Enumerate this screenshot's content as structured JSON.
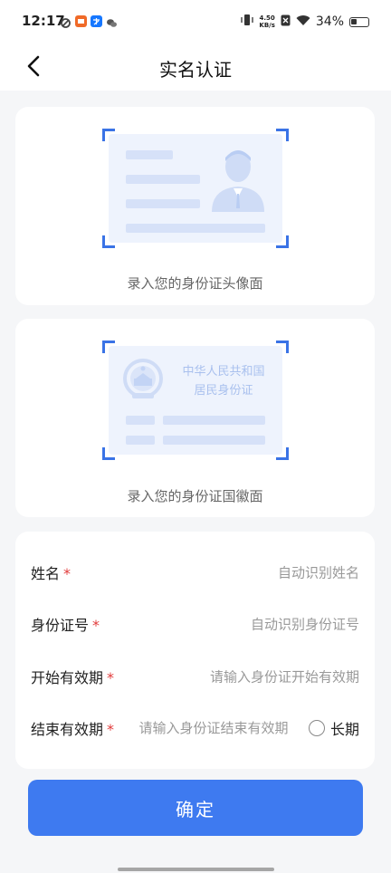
{
  "status_bar": {
    "time": "12:17",
    "net_speed_value": "4.50",
    "net_speed_unit": "KB/s",
    "battery": "34%"
  },
  "header": {
    "title": "实名认证",
    "back_icon": "chevron-left-icon"
  },
  "front_card": {
    "caption": "录入您的身份证头像面"
  },
  "back_card": {
    "emblem_line1": "中华人民共和国",
    "emblem_line2": "居民身份证",
    "caption": "录入您的身份证国徽面"
  },
  "form": {
    "rows": [
      {
        "label": "姓名",
        "required": "*",
        "placeholder": "自动识别姓名"
      },
      {
        "label": "身份证号",
        "required": "*",
        "placeholder": "自动识别身份证号"
      },
      {
        "label": "开始有效期",
        "required": "*",
        "placeholder": "请输入身份证开始有效期"
      },
      {
        "label": "结束有效期",
        "required": "*",
        "placeholder": "请输入身份证结束有效期"
      }
    ],
    "long_term_label": "长期"
  },
  "confirm_button": "确定",
  "colors": {
    "accent": "#3e7af0",
    "required": "#e23b3b",
    "scan_corner": "#3a73e6"
  }
}
